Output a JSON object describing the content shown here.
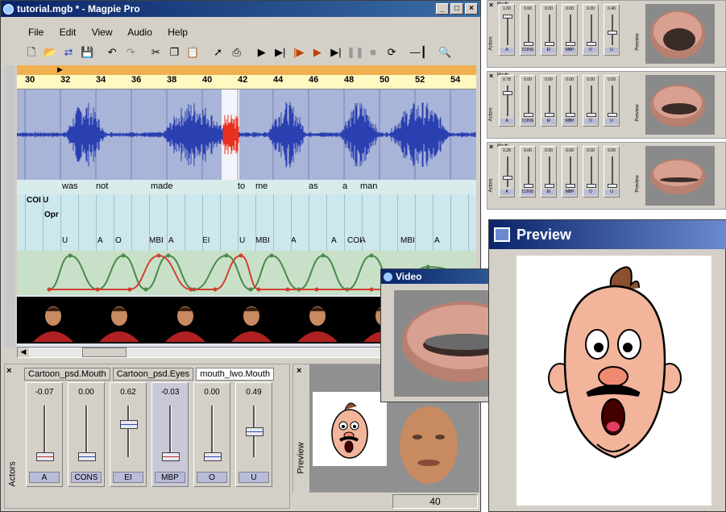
{
  "main_window": {
    "title": "tutorial.mgb * - Magpie Pro",
    "menu": [
      "File",
      "Edit",
      "View",
      "Audio",
      "Help"
    ],
    "ruler_ticks": [
      "30",
      "32",
      "34",
      "36",
      "38",
      "40",
      "42",
      "44",
      "46",
      "48",
      "50",
      "52",
      "54"
    ],
    "words": [
      "was",
      "not",
      "made",
      "to",
      "me",
      "as",
      "a",
      "man"
    ],
    "phonemes_row1": [
      "COI",
      "U"
    ],
    "phonemes_row2": [
      "Opr"
    ],
    "phonemes_row4": [
      "U",
      "A",
      "O",
      "MBI",
      "A",
      "EI",
      "U",
      "MBI",
      "A",
      "A",
      "COI",
      "A",
      "MBI",
      "A"
    ],
    "frame_counter": "40"
  },
  "slider_panel": {
    "tabs": [
      "Cartoon_psd.Mouth",
      "Cartoon_psd.Eyes",
      "mouth_lwo.Mouth"
    ],
    "side_label": "Actors",
    "sliders": [
      {
        "value": "-0.07",
        "label": "A",
        "level": 0.0,
        "color": "#c03030"
      },
      {
        "value": "0.00",
        "label": "CONS",
        "level": 0.0,
        "color": "#3050b0"
      },
      {
        "value": "0.62",
        "label": "EI",
        "level": 0.62,
        "color": "#3050b0"
      },
      {
        "value": "-0.03",
        "label": "MBP",
        "level": 0.0,
        "color": "#c03030"
      },
      {
        "value": "0.00",
        "label": "O",
        "level": 0.0,
        "color": "#3050b0"
      },
      {
        "value": "0.49",
        "label": "U",
        "level": 0.49,
        "color": "#3050b0"
      }
    ]
  },
  "preview_panel": {
    "side_label": "Preview"
  },
  "video_window": {
    "title": "Video"
  },
  "preview_window": {
    "title": "Preview"
  },
  "mini_panels": [
    {
      "title": "Mouth",
      "values": [
        "1.00",
        "0.00",
        "0.00",
        "0.00",
        "0.00",
        "0.40"
      ],
      "labels": [
        "A",
        "CONS",
        "EI",
        "MBP",
        "O",
        "U"
      ],
      "side_left": "Actors",
      "side_right": "Preview"
    },
    {
      "title": "Mouth",
      "values": [
        "0.78",
        "0.00",
        "0.00",
        "0.00",
        "0.00",
        "0.00"
      ],
      "labels": [
        "A",
        "CONS",
        "EI",
        "MBP",
        "O",
        "U"
      ],
      "side_left": "Actors",
      "side_right": "Preview"
    },
    {
      "title": "Mouth",
      "values": [
        "0.28",
        "0.00",
        "0.00",
        "0.00",
        "0.00",
        "0.00"
      ],
      "labels": [
        "A",
        "CONS",
        "EI",
        "MBP",
        "O",
        "U"
      ],
      "side_left": "Actors",
      "side_right": "Preview"
    }
  ],
  "colors": {
    "titlebar": "#0a246a",
    "waveform": "#2a3fb0",
    "highlight": "#e83020",
    "timeline_bg": "#e0e4ef",
    "ruler": "#fff8c0"
  },
  "icons": [
    "new-icon",
    "open-icon",
    "import-icon",
    "save-icon",
    "undo-icon",
    "redo-icon",
    "cut-icon",
    "copy-icon",
    "paste-icon",
    "export-icon",
    "print-icon",
    "play-icon",
    "play-selection-icon",
    "play-marker-icon",
    "play-loop-icon",
    "step-icon",
    "pause-icon",
    "stop-icon",
    "loop-icon",
    "zoom-slider-icon",
    "zoom-icon"
  ]
}
